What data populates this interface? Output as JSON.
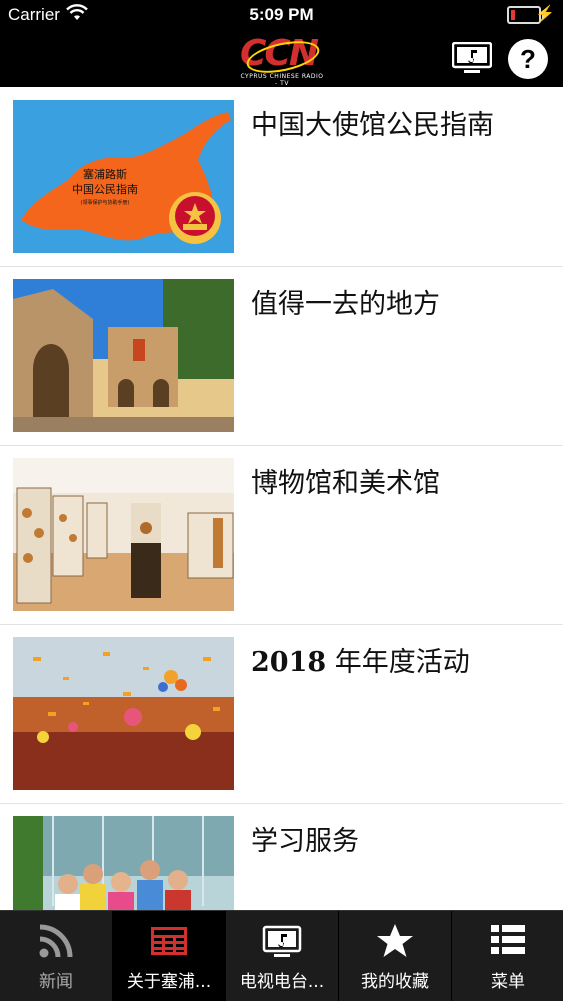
{
  "status": {
    "carrier": "Carrier",
    "time": "5:09 PM"
  },
  "header": {
    "logo_text": "CCN",
    "logo_sub": "CYPRUS CHINESE RADIO - TV",
    "tv_icon": "tv-music-icon",
    "help_label": "?"
  },
  "list": {
    "items": [
      {
        "title": "中国大使馆公民指南",
        "image_text_1": "塞浦路斯",
        "image_text_2": "中国公民指南",
        "image_text_3": "(领事保护与协助手册)"
      },
      {
        "title": "值得一去的地方"
      },
      {
        "title": "博物馆和美术馆"
      },
      {
        "title_num": "2018",
        "title": " 年年度活动"
      },
      {
        "title": "学习服务"
      }
    ]
  },
  "tabbar": {
    "tabs": [
      {
        "label": "新闻",
        "icon": "rss-icon"
      },
      {
        "label": "关于塞浦...",
        "icon": "newspaper-icon"
      },
      {
        "label": "电视电台...",
        "icon": "tv-music-icon"
      },
      {
        "label": "我的收藏",
        "icon": "star-icon"
      },
      {
        "label": "菜单",
        "icon": "menu-list-icon"
      }
    ],
    "active_index": 1
  },
  "colors": {
    "brand_red": "#d32f2f",
    "accent_orange": "#f4661b",
    "bar_bg": "#000000"
  }
}
